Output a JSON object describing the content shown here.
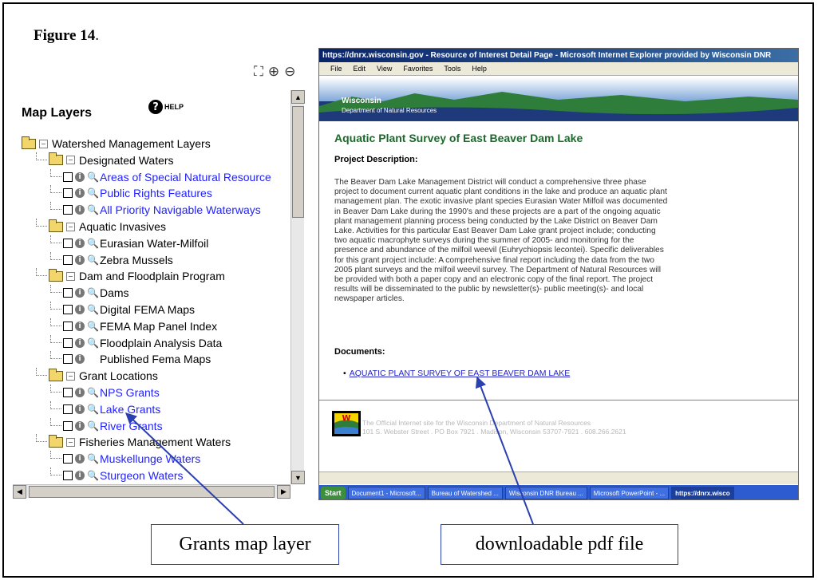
{
  "figure": {
    "title": "Figure 14",
    "title_suffix": "."
  },
  "map_layers": {
    "title": "Map Layers",
    "help_label": "HELP",
    "tools": {
      "fullscreen": "⛶",
      "zoom_in": "⊕",
      "zoom_out": "⊖"
    },
    "tree": [
      {
        "level": 0,
        "type": "folder",
        "label": "Watershed Management Layers"
      },
      {
        "level": 1,
        "type": "folder",
        "label": "Designated Waters"
      },
      {
        "level": 2,
        "type": "layer",
        "label": "Areas of Special Natural Resource",
        "link": true,
        "mag": true
      },
      {
        "level": 2,
        "type": "layer",
        "label": "Public Rights Features",
        "link": true,
        "mag": true
      },
      {
        "level": 2,
        "type": "layer",
        "label": "All Priority Navigable Waterways",
        "link": true,
        "mag": true
      },
      {
        "level": 1,
        "type": "folder",
        "label": "Aquatic Invasives"
      },
      {
        "level": 2,
        "type": "layer",
        "label": "Eurasian Water-Milfoil",
        "link": false,
        "mag": true
      },
      {
        "level": 2,
        "type": "layer",
        "label": "Zebra Mussels",
        "link": false,
        "mag": true
      },
      {
        "level": 1,
        "type": "folder",
        "label": "Dam and Floodplain Program"
      },
      {
        "level": 2,
        "type": "layer",
        "label": "Dams",
        "link": false,
        "mag": true
      },
      {
        "level": 2,
        "type": "layer",
        "label": "Digital FEMA Maps",
        "link": false,
        "mag": true
      },
      {
        "level": 2,
        "type": "layer",
        "label": "FEMA Map Panel Index",
        "link": false,
        "mag": true
      },
      {
        "level": 2,
        "type": "layer",
        "label": "Floodplain Analysis Data",
        "link": false,
        "mag": true
      },
      {
        "level": 2,
        "type": "layer",
        "label": "Published Fema Maps",
        "link": false,
        "mag": false
      },
      {
        "level": 1,
        "type": "folder",
        "label": "Grant Locations"
      },
      {
        "level": 2,
        "type": "layer",
        "label": "NPS Grants",
        "link": true,
        "mag": true
      },
      {
        "level": 2,
        "type": "layer",
        "label": "Lake Grants",
        "link": true,
        "mag": true
      },
      {
        "level": 2,
        "type": "layer",
        "label": "River Grants",
        "link": true,
        "mag": true
      },
      {
        "level": 1,
        "type": "folder",
        "label": "Fisheries Management Waters"
      },
      {
        "level": 2,
        "type": "layer",
        "label": "Muskellunge Waters",
        "link": true,
        "mag": true
      },
      {
        "level": 2,
        "type": "layer",
        "label": "Sturgeon Waters",
        "link": true,
        "mag": true
      }
    ]
  },
  "browser": {
    "window_title": "https://dnrx.wisconsin.gov - Resource of Interest Detail Page - Microsoft Internet Explorer provided by Wisconsin DNR",
    "menu": [
      "File",
      "Edit",
      "View",
      "Favorites",
      "Tools",
      "Help"
    ],
    "banner": {
      "state": "Wisconsin",
      "agency": "Department of Natural Resources"
    },
    "page_title": "Aquatic Plant Survey of East Beaver Dam Lake",
    "project_description_label": "Project Description",
    "project_description": "The Beaver Dam Lake Management District will conduct a comprehensive three phase project to document current aquatic plant conditions in the lake and produce an aquatic plant management plan. The exotic invasive plant species Eurasian Water Milfoil was documented in Beaver Dam Lake during the 1990's and these projects are a part of the ongoing aquatic plant management planning process being conducted by the Lake District on Beaver Dam Lake. Activities for this particular East Beaver Dam Lake grant project include; conducting two aquatic macrophyte surveys during the summer of 2005- and monitoring for the presence and abundance of the milfoil weevil (Euhrychiopsis lecontei). Specific deliverables for this grant project include: A comprehensive final report including the data from the two 2005 plant surveys and the milfoil weevil survey. The Department of Natural Resources will be provided with both a paper copy and an electronic copy of the final report. The project results will be disseminated to the public by newsletter(s)- public meeting(s)- and local newspaper articles.",
    "documents_label": "Documents",
    "document_link": "AQUATIC PLANT SURVEY OF EAST BEAVER DAM LAKE",
    "footer_line1": "The Official Internet site for the Wisconsin Department of Natural Resources",
    "footer_line2": "101 S. Webster Street . PO Box 7921 . Madison, Wisconsin 53707-7921 . 608.266.2621",
    "taskbar": {
      "start": "Start",
      "tasks": [
        "Document1 - Microsoft...",
        "Bureau of Watershed ...",
        "Wisconsin DNR Bureau ...",
        "Microsoft PowerPoint - ...",
        "https://dnrx.wisco"
      ]
    }
  },
  "callouts": {
    "grants": "Grants map layer",
    "pdf": "downloadable pdf file"
  },
  "colors": {
    "link": "#2222ff",
    "arrow": "#2a3fb0",
    "page_title": "#1a6a2a"
  }
}
